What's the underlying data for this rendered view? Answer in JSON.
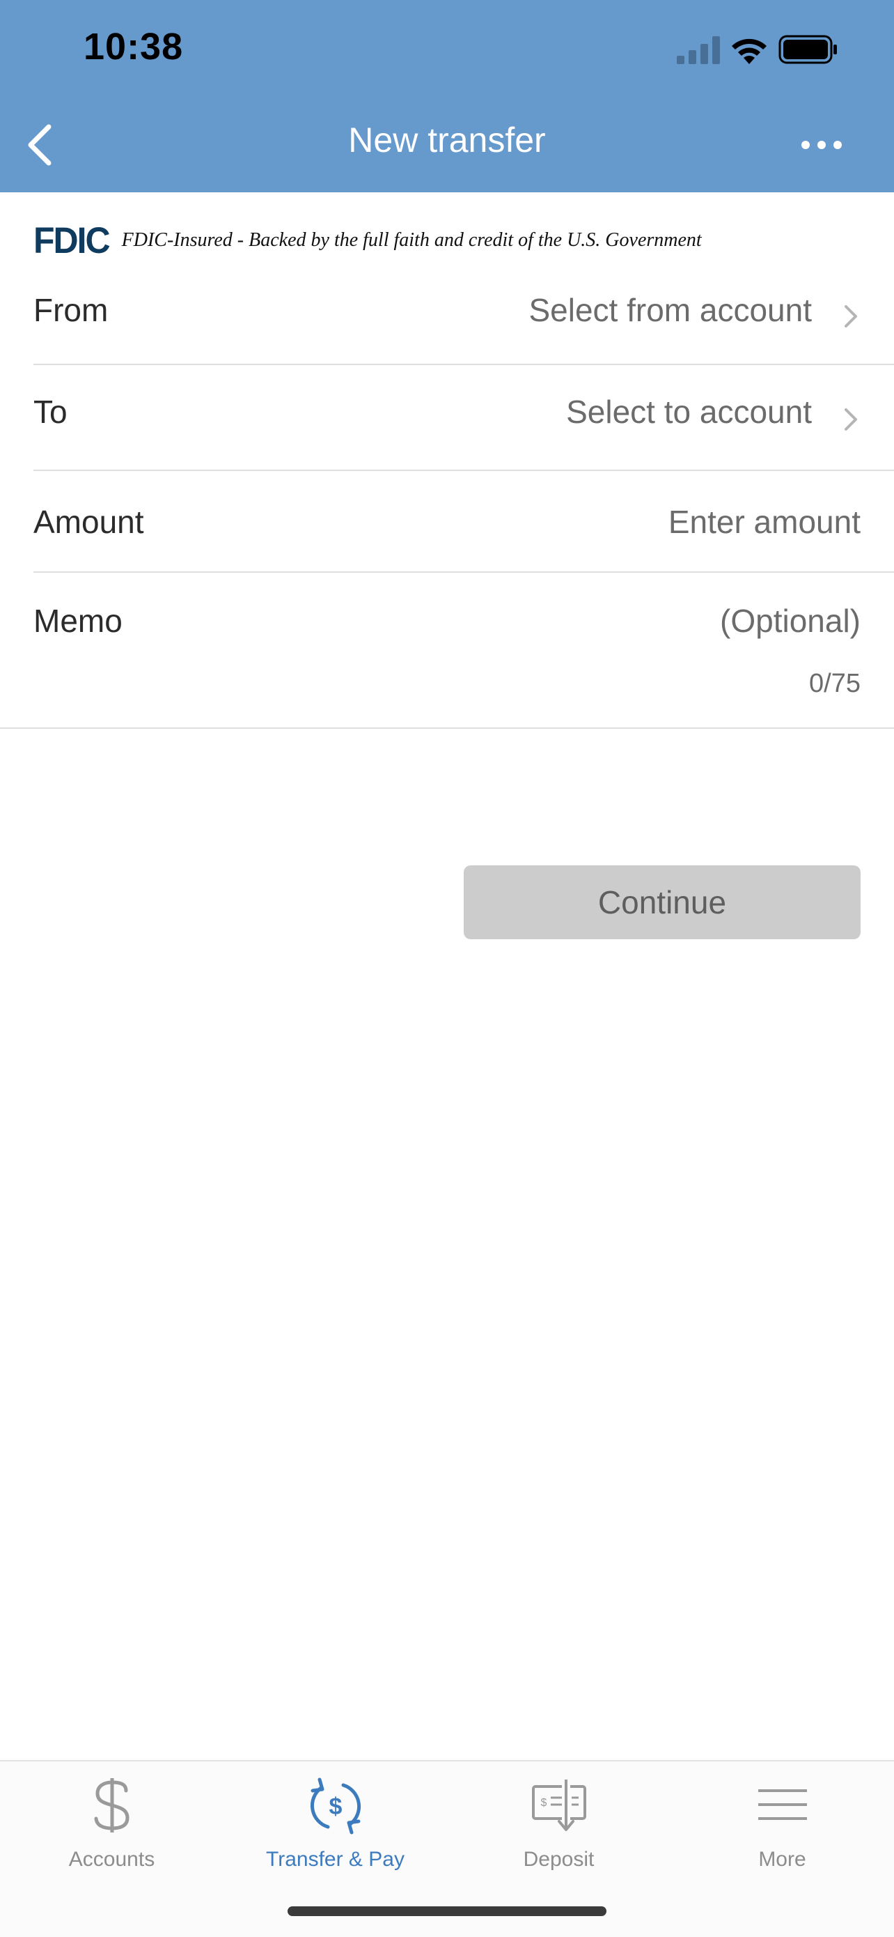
{
  "status_bar": {
    "time": "10:38"
  },
  "header": {
    "title": "New transfer",
    "background_color": "#6699cc"
  },
  "fdic": {
    "logo": "FDIC",
    "text": "FDIC-Insured - Backed by the full faith and credit of the U.S. Government"
  },
  "form": {
    "from": {
      "label": "From",
      "value": "Select from account"
    },
    "to": {
      "label": "To",
      "value": "Select to account"
    },
    "amount": {
      "label": "Amount",
      "placeholder": "Enter amount"
    },
    "memo": {
      "label": "Memo",
      "placeholder": "(Optional)",
      "counter": "0/75"
    }
  },
  "continue_button": {
    "label": "Continue",
    "enabled": false
  },
  "tabbar": {
    "tabs": [
      {
        "label": "Accounts",
        "icon": "dollar-icon",
        "active": false
      },
      {
        "label": "Transfer & Pay",
        "icon": "transfer-icon",
        "active": true
      },
      {
        "label": "Deposit",
        "icon": "deposit-check-icon",
        "active": false
      },
      {
        "label": "More",
        "icon": "menu-icon",
        "active": false
      }
    ],
    "active_color": "#3d7bbf",
    "inactive_color": "#8c8c8c"
  }
}
